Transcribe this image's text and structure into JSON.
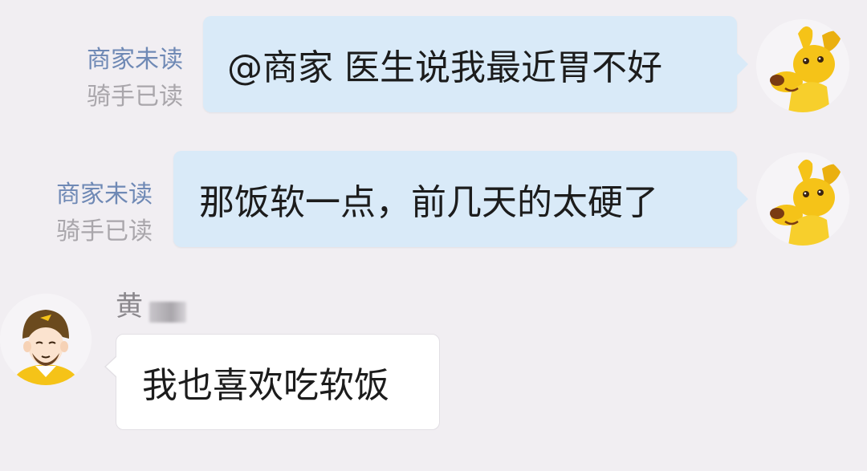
{
  "messages": [
    {
      "direction": "out",
      "text": "@商家 医生说我最近胃不好",
      "status_merchant": "商家未读",
      "status_rider": "骑手已读",
      "avatar": "dog-mascot-icon"
    },
    {
      "direction": "out",
      "text": "那饭软一点，前几天的太硬了",
      "status_merchant": "商家未读",
      "status_rider": "骑手已读",
      "avatar": "dog-mascot-icon"
    },
    {
      "direction": "in",
      "sender": "黄",
      "text": "我也喜欢吃软饭",
      "avatar": "rider-helmet-avatar-icon"
    }
  ],
  "colors": {
    "background": "#f1eef2",
    "outgoing_bubble": "#d9eaf8",
    "incoming_bubble": "#ffffff",
    "status_unread": "#6f89b5",
    "status_read": "#a9a6ab",
    "mascot_yellow": "#f5c318"
  }
}
